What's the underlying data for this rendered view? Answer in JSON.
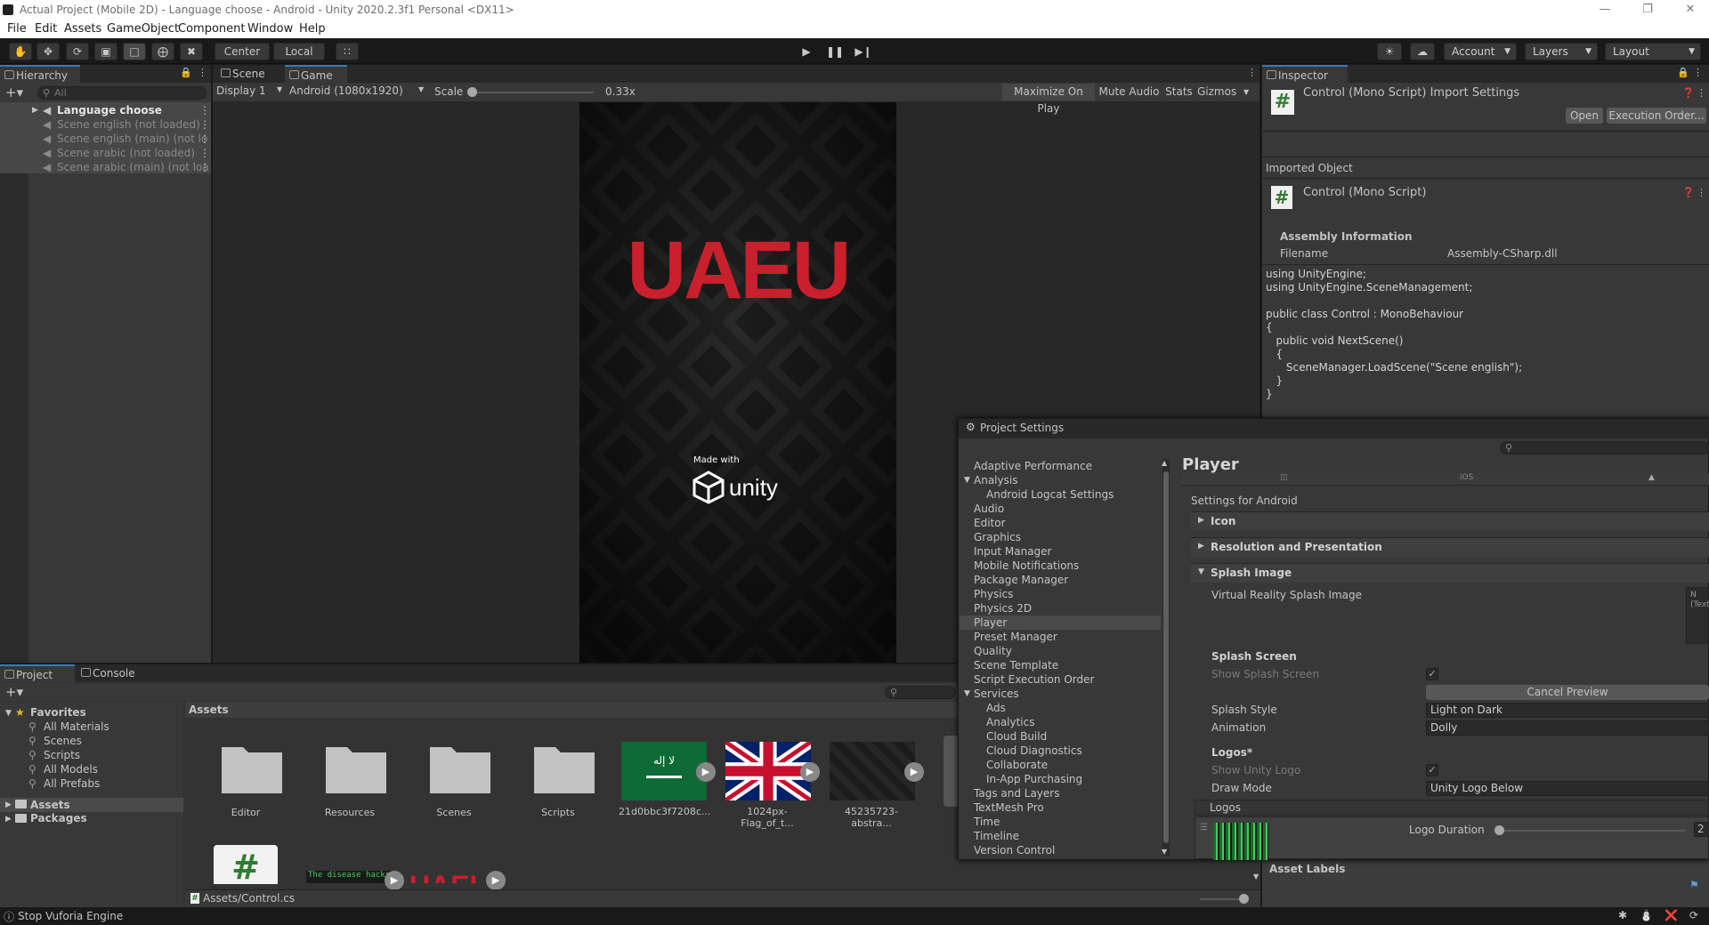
{
  "window": {
    "title": "Actual Project (Mobile 2D) - Language choose - Android - Unity 2020.2.3f1 Personal <DX11>"
  },
  "menu": [
    "File",
    "Edit",
    "Assets",
    "GameObject",
    "Component",
    "Window",
    "Help"
  ],
  "toolbar": {
    "center_label": "Center",
    "local_label": "Local",
    "account_label": "Account",
    "layers_label": "Layers",
    "layout_label": "Layout"
  },
  "hierarchy": {
    "tab_label": "Hierarchy",
    "search_placeholder": "All",
    "items": [
      {
        "label": "Language choose",
        "bold": true
      },
      {
        "label": "Scene english (not loaded)"
      },
      {
        "label": "Scene english (main) (not lo"
      },
      {
        "label": "Scene arabic (not loaded)"
      },
      {
        "label": "Scene arabic (main) (not loa"
      }
    ]
  },
  "game_view": {
    "tabs": [
      {
        "label": "Scene"
      },
      {
        "label": "Game"
      }
    ],
    "display": "Display 1",
    "resolution": "Android (1080x1920)",
    "scale_label": "Scale",
    "scale_value": "0.33x",
    "buttons": [
      "Maximize On Play",
      "Mute Audio",
      "Stats",
      "Gizmos"
    ],
    "logo_text": "UAEU",
    "made_with": "Made with",
    "unity_text": "unity"
  },
  "inspector": {
    "tab_label": "Inspector",
    "header": "Control (Mono Script) Import Settings",
    "open_label": "Open",
    "exec_order_label": "Execution Order...",
    "imported_object": "Imported Object",
    "script_title": "Control (Mono Script)",
    "assembly_info": "Assembly Information",
    "filename_label": "Filename",
    "filename_value": "Assembly-CSharp.dll",
    "code": [
      "using UnityEngine;",
      "using UnityEngine.SceneManagement;",
      "",
      "public class Control : MonoBehaviour",
      "{",
      "   public void NextScene()",
      "   {",
      "      SceneManager.LoadScene(\"Scene english\");",
      "   }",
      "}"
    ],
    "asset_labels": "Asset Labels"
  },
  "project": {
    "tabs": [
      {
        "label": "Project"
      },
      {
        "label": "Console"
      }
    ],
    "favorites_label": "Favorites",
    "favorites": [
      "All Materials",
      "Scenes",
      "Scripts",
      "All Models",
      "All Prefabs"
    ],
    "roots": [
      "Assets",
      "Packages"
    ],
    "assets_header": "Assets",
    "tiles": [
      {
        "label": "Editor",
        "kind": "folder"
      },
      {
        "label": "Resources",
        "kind": "folder"
      },
      {
        "label": "Scenes",
        "kind": "folder"
      },
      {
        "label": "Scripts",
        "kind": "folder"
      },
      {
        "label": "21d0bbc3f7208c...",
        "kind": "flag-sa"
      },
      {
        "label": "1024px-Flag_of_t...",
        "kind": "flag-uk"
      },
      {
        "label": "45235723-abstra...",
        "kind": "dark"
      }
    ],
    "row2_text": "The disease hacks",
    "path": "Assets/Control.cs"
  },
  "project_settings": {
    "title": "Project Settings",
    "items": [
      {
        "label": "Adaptive Performance"
      },
      {
        "label": "Analysis",
        "fold": true
      },
      {
        "label": "Android Logcat Settings",
        "sub": true
      },
      {
        "label": "Audio"
      },
      {
        "label": "Editor"
      },
      {
        "label": "Graphics"
      },
      {
        "label": "Input Manager"
      },
      {
        "label": "Mobile Notifications"
      },
      {
        "label": "Package Manager"
      },
      {
        "label": "Physics"
      },
      {
        "label": "Physics 2D"
      },
      {
        "label": "Player",
        "selected": true
      },
      {
        "label": "Preset Manager"
      },
      {
        "label": "Quality"
      },
      {
        "label": "Scene Template"
      },
      {
        "label": "Script Execution Order"
      },
      {
        "label": "Services",
        "fold": true
      },
      {
        "label": "Ads",
        "sub": true
      },
      {
        "label": "Analytics",
        "sub": true
      },
      {
        "label": "Cloud Build",
        "sub": true
      },
      {
        "label": "Cloud Diagnostics",
        "sub": true
      },
      {
        "label": "Collaborate",
        "sub": true
      },
      {
        "label": "In-App Purchasing",
        "sub": true
      },
      {
        "label": "Tags and Layers"
      },
      {
        "label": "TextMesh Pro"
      },
      {
        "label": "Time"
      },
      {
        "label": "Timeline"
      },
      {
        "label": "Version Control"
      }
    ],
    "player_title": "Player",
    "platform_tab_text": "iOS",
    "settings_for": "Settings for Android",
    "sections": [
      "Icon",
      "Resolution and Presentation",
      "Splash Image"
    ],
    "vr_splash": "Virtual Reality Splash Image",
    "vr_box_text": "N\n(Text",
    "splash_screen": "Splash Screen",
    "show_splash": "Show Splash Screen",
    "cancel_preview": "Cancel Preview",
    "splash_style_label": "Splash Style",
    "splash_style_value": "Light on Dark",
    "animation_label": "Animation",
    "animation_value": "Dolly",
    "logos_label": "Logos*",
    "show_unity_logo": "Show Unity Logo",
    "draw_mode_label": "Draw Mode",
    "draw_mode_value": "Unity Logo Below",
    "logos_list": "Logos",
    "logo_duration_label": "Logo Duration",
    "logo_duration_value": "2"
  },
  "status": {
    "text": "Stop Vuforia Engine"
  }
}
